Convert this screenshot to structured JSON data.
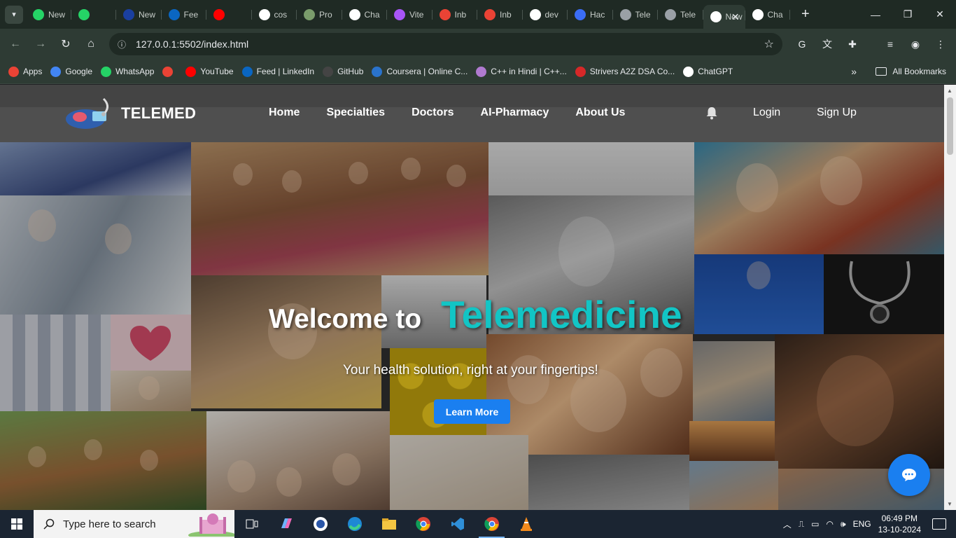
{
  "browser": {
    "tabs": [
      {
        "label": "New",
        "icon": "whatsapp-icon",
        "color": "#25d366"
      },
      {
        "label": "",
        "icon": "speaker-icon",
        "color": "#25d366"
      },
      {
        "label": "New",
        "icon": "d-icon",
        "color": "#1a3fa0"
      },
      {
        "label": "Fee",
        "icon": "linkedin-icon",
        "color": "#0a66c2"
      },
      {
        "label": "",
        "icon": "youtube-icon",
        "color": "#ff0000"
      },
      {
        "label": "cos",
        "icon": "google-icon",
        "color": "#ffffff"
      },
      {
        "label": "Pro",
        "icon": "people-icon",
        "color": "#7a9c6b"
      },
      {
        "label": "Cha",
        "icon": "chatgpt-icon",
        "color": "#ffffff"
      },
      {
        "label": "Vite",
        "icon": "vite-icon",
        "color": "#a855f7"
      },
      {
        "label": "Inb",
        "icon": "gmail-icon",
        "color": "#ea4335"
      },
      {
        "label": "Inb",
        "icon": "gmail-icon",
        "color": "#ea4335"
      },
      {
        "label": "dev",
        "icon": "google-icon",
        "color": "#ffffff"
      },
      {
        "label": "Hac",
        "icon": "hackathon-icon",
        "color": "#3b6df6"
      },
      {
        "label": "Tele",
        "icon": "globe-icon",
        "color": "#9aa0a6"
      },
      {
        "label": "Tele",
        "icon": "globe-icon",
        "color": "#9aa0a6"
      },
      {
        "label": "New",
        "icon": "chrome-icon",
        "color": "#ffffff"
      },
      {
        "label": "Cha",
        "icon": "chatgpt-icon",
        "color": "#ffffff"
      }
    ],
    "active_tab_close": "✕",
    "new_tab": "+",
    "window_controls": [
      "—",
      "❐",
      "✕"
    ],
    "url": "127.0.0.1:5502/index.html",
    "bookmarks": [
      {
        "label": "Apps",
        "icon": "apps-grid-icon",
        "color": "#ea4335"
      },
      {
        "label": "Google",
        "icon": "google-icon",
        "color": "#4285f4"
      },
      {
        "label": "WhatsApp",
        "icon": "whatsapp-icon",
        "color": "#25d366"
      },
      {
        "label": "",
        "icon": "gmail-icon",
        "color": "#ea4335"
      },
      {
        "label": "YouTube",
        "icon": "youtube-icon",
        "color": "#ff0000"
      },
      {
        "label": "Feed | LinkedIn",
        "icon": "linkedin-icon",
        "color": "#0a66c2"
      },
      {
        "label": "GitHub",
        "icon": "github-icon",
        "color": "#444444"
      },
      {
        "label": "Coursera | Online C...",
        "icon": "coursera-icon",
        "color": "#2a73cc"
      },
      {
        "label": "C++ in Hindi | C++...",
        "icon": "avatar-icon",
        "color": "#b07ad0"
      },
      {
        "label": "Strivers A2Z DSA Co...",
        "icon": "tuf-icon",
        "color": "#d62828"
      },
      {
        "label": "ChatGPT",
        "icon": "chatgpt-icon",
        "color": "#ffffff"
      }
    ],
    "bookmarks_more": "»",
    "all_bookmarks": "All Bookmarks"
  },
  "site": {
    "brand": "TELEMED",
    "nav": [
      "Home",
      "Specialties",
      "Doctors",
      "AI-Pharmacy",
      "About Us"
    ],
    "login": "Login",
    "signup": "Sign Up",
    "hero": {
      "welcome": "Welcome to",
      "brand": "Telemedicine",
      "subtitle": "Your health solution, right at your fingertips!",
      "cta": "Learn More"
    },
    "accent": "#12c5c5",
    "button_color": "#1a7ff0"
  },
  "taskbar": {
    "search_placeholder": "Type here to search",
    "apps": [
      "task-view-icon",
      "copilot-icon",
      "app-shield-icon",
      "edge-icon",
      "file-explorer-icon",
      "chrome-icon",
      "vscode-icon",
      "chrome-icon",
      "vlc-icon"
    ],
    "language": "ENG",
    "time": "06:49 PM",
    "date": "13-10-2024"
  }
}
